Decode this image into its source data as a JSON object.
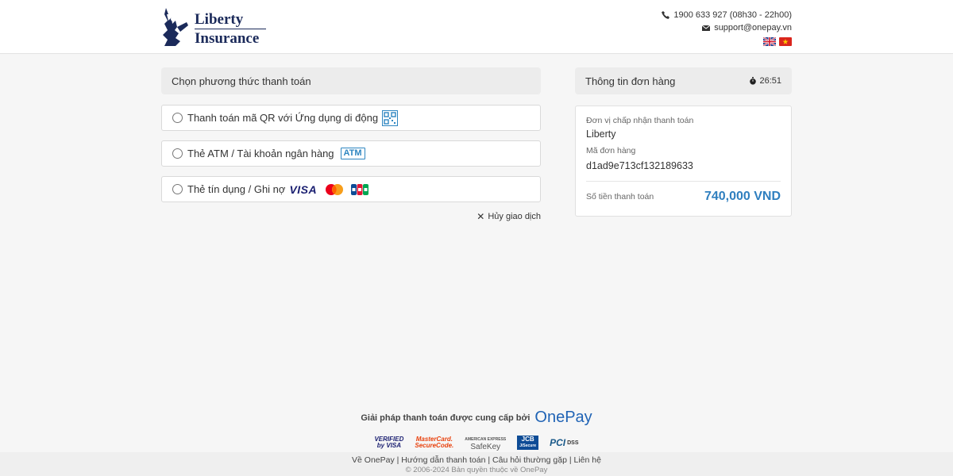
{
  "brand": {
    "line1": "Liberty",
    "line2": "Insurance"
  },
  "contact": {
    "phone": "1900 633 927 (08h30 - 22h00)",
    "email": "support@onepay.vn"
  },
  "payment": {
    "title": "Chọn phương thức thanh toán",
    "options": [
      {
        "label": "Thanh toán mã QR với Ứng dụng di động",
        "icon": "qr-code-icon"
      },
      {
        "label": "Thẻ ATM / Tài khoản ngân hàng",
        "badge": "ATM"
      },
      {
        "label": "Thẻ tín dụng / Ghi nợ",
        "brands": [
          "VISA",
          "Mastercard",
          "JCB"
        ]
      }
    ],
    "cancel_label": "Hủy giao dịch"
  },
  "order": {
    "title": "Thông tin đơn hàng",
    "timer": "26:51",
    "merchant_label": "Đơn vị chấp nhận thanh toán",
    "merchant_value": "Liberty",
    "order_id_label": "Mã đơn hàng",
    "order_id_value": "d1ad9e713cf132189633",
    "amount_label": "Số tiền thanh toán",
    "amount_value": "740,000 VND"
  },
  "footer": {
    "powered_by": "Giải pháp thanh toán được cung cấp bởi",
    "provider": "OnePay",
    "certs": {
      "visa_l1": "VERIFIED",
      "visa_l2": "by VISA",
      "mc_l1": "MasterCard.",
      "mc_l2": "SecureCode.",
      "amex_l1": "AMERICAN EXPRESS",
      "amex_l2": "SafeKey",
      "jcb_l1": "JCB",
      "jcb_l2": "J/Secure",
      "pci_l1": "PCI",
      "pci_l2": "DSS"
    },
    "links": [
      "Về OnePay",
      "Hướng dẫn thanh toán",
      "Câu hỏi thường gặp",
      "Liên hệ"
    ],
    "copyright": "© 2006-2024 Bản quyền thuộc về OnePay"
  },
  "colors": {
    "accent": "#2f7fbf",
    "brand_navy": "#1b2a5a",
    "onepay_blue": "#1f63b5"
  }
}
